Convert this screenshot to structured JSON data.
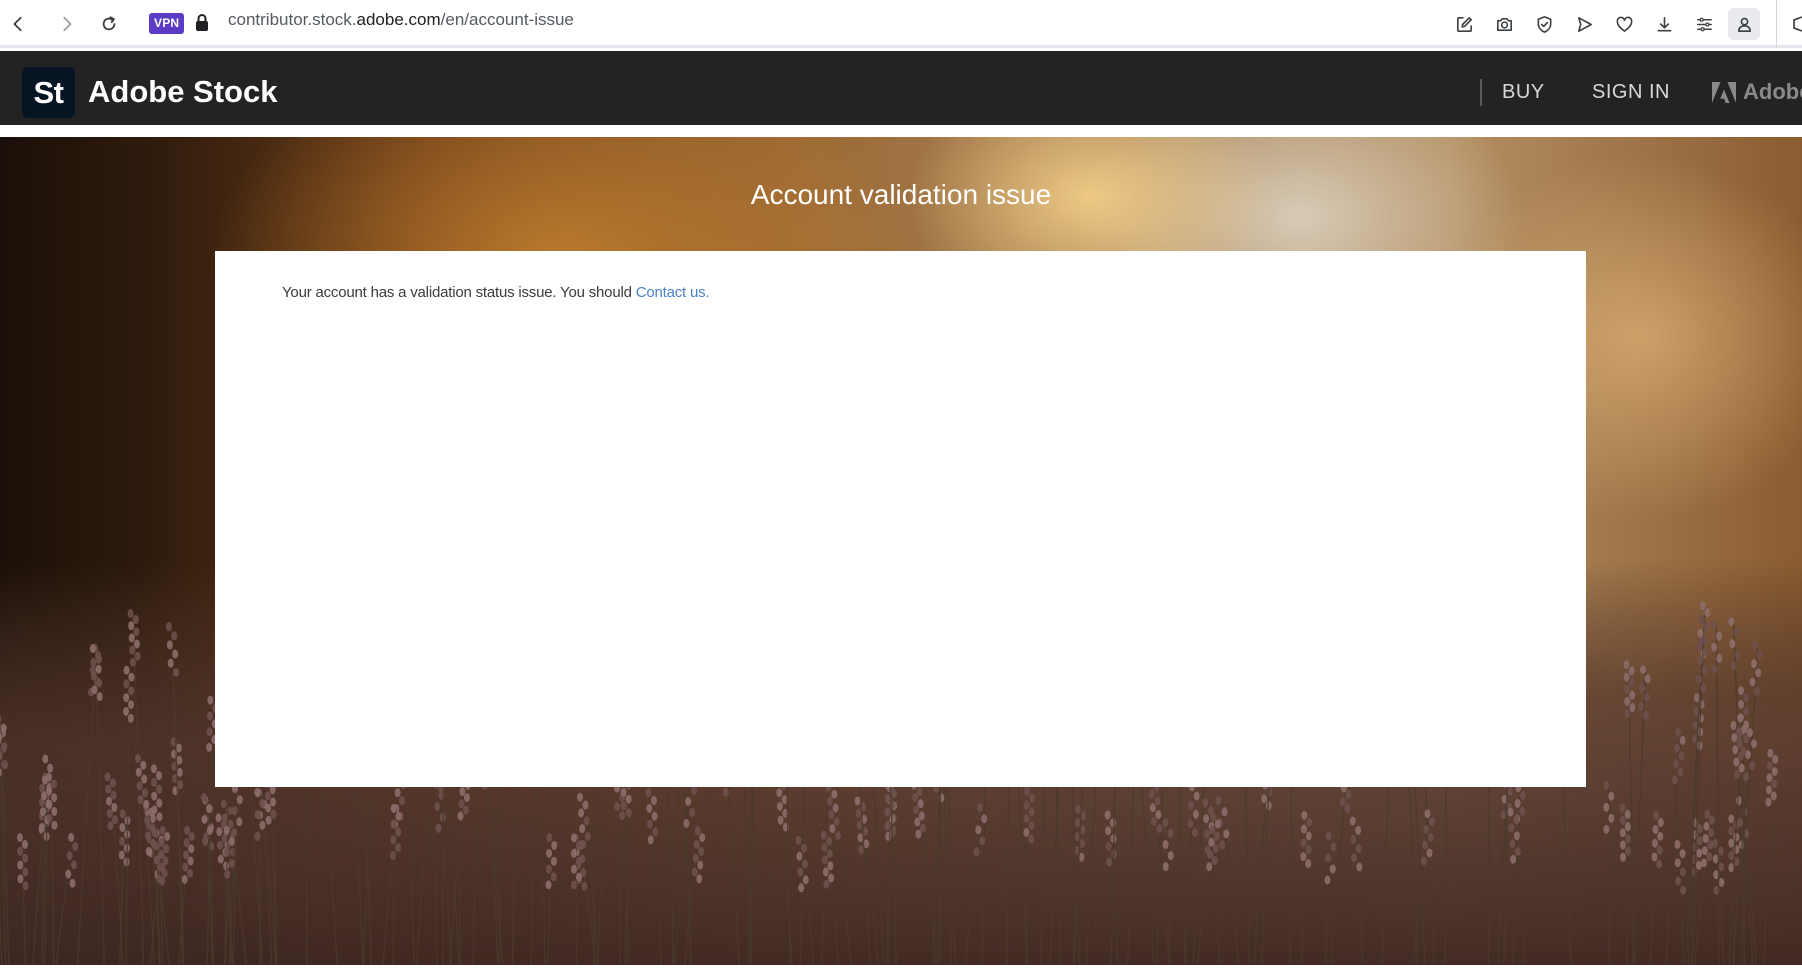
{
  "browser": {
    "vpn_label": "VPN",
    "url_prefix": "contributor.stock.",
    "url_domain": "adobe.com",
    "url_path": "/en/account-issue"
  },
  "header": {
    "logo_text": "St",
    "brand_name": "Adobe Stock",
    "buy_label": "BUY",
    "sign_in_label": "SIGN IN",
    "adobe_label": "Adobe"
  },
  "page": {
    "title": "Account validation issue",
    "message_text": "Your account has a validation status issue. You should ",
    "contact_link": "Contact us."
  },
  "colors": {
    "header_bg": "#232323",
    "logo_bg": "#061423",
    "link": "#4a82c6",
    "vpn_badge": "#5b3cc4"
  }
}
